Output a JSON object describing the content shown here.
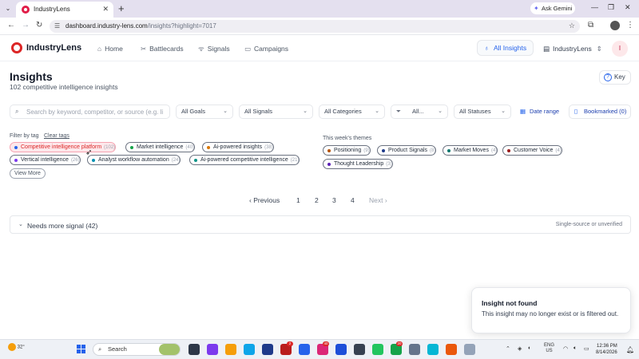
{
  "browser": {
    "tab_title": "IndustryLens",
    "gemini_label": "Ask Gemini",
    "url_host": "dashboard.industry-lens.com",
    "url_path": "/insights?highlight=7017"
  },
  "header": {
    "brand": "IndustryLens",
    "nav": [
      {
        "label": "Home",
        "icon": "home-icon"
      },
      {
        "label": "Battlecards",
        "icon": "battlecards-icon"
      },
      {
        "label": "Signals",
        "icon": "signals-icon"
      },
      {
        "label": "Campaigns",
        "icon": "campaigns-icon"
      }
    ],
    "all_insights_label": "All Insights",
    "org_label": "IndustryLens",
    "user_initial": "I"
  },
  "page": {
    "title": "Insights",
    "subtitle": "102 competitive intelligence insights",
    "key_label": "Key"
  },
  "filters": {
    "search_placeholder": "Search by keyword, competitor, or source (e.g. li",
    "goals": "All Goals",
    "signals": "All Signals",
    "categories": "All Categories",
    "type": "All...",
    "statuses": "All Statuses",
    "date_range": "Date range",
    "bookmarked": "Bookmarked (0)"
  },
  "tags": {
    "label": "Filter by tag",
    "clear_label": "Clear tags",
    "items": [
      {
        "label": "Competitive intelligence platform",
        "count": "(102)",
        "color": "#2563eb"
      },
      {
        "label": "Market intelligence",
        "count": "(40)",
        "color": "#16a34a"
      },
      {
        "label": "Ai-powered insights",
        "count": "(38)",
        "color": "#d97706"
      },
      {
        "label": "Vertical intelligence",
        "count": "(26)",
        "color": "#7c3aed"
      },
      {
        "label": "Analyst workflow automation",
        "count": "(24)",
        "color": "#0891b2"
      },
      {
        "label": "Ai-powered competitive intelligence",
        "count": "(21)",
        "color": "#0d9488"
      }
    ],
    "view_more": "View More"
  },
  "themes": {
    "label": "This week's themes",
    "items": [
      {
        "label": "Positioning",
        "count": "(9)",
        "color": "#b45309"
      },
      {
        "label": "Product Signals",
        "count": "(8)",
        "color": "#1e3a8a"
      },
      {
        "label": "Market Moves",
        "count": "(4)",
        "color": "#0f766e"
      },
      {
        "label": "Customer Voice",
        "count": "(4)",
        "color": "#991b1b"
      },
      {
        "label": "Thought Leadership",
        "count": "(3)",
        "color": "#5b21b6"
      }
    ]
  },
  "pagination": {
    "previous": "‹ Previous",
    "pages": [
      "1",
      "2",
      "3",
      "4"
    ],
    "next": "Next ›"
  },
  "collapsible": {
    "title": "Needs more signal (42)",
    "note": "Single-source or unverified"
  },
  "toast": {
    "title": "Insight not found",
    "body": "This insight may no longer exist or is filtered out."
  },
  "taskbar": {
    "temperature": "32°",
    "search_label": "Search",
    "badge_1": "2",
    "badge_2": "40",
    "badge_3": "20",
    "lang_line1": "ENG",
    "lang_line2": "US",
    "time": "12:36 PM",
    "date": "8/14/2026"
  },
  "colors": {
    "accent": "#2563eb",
    "brand": "#dc2626",
    "active_tag_bg": "#fde8eb"
  }
}
